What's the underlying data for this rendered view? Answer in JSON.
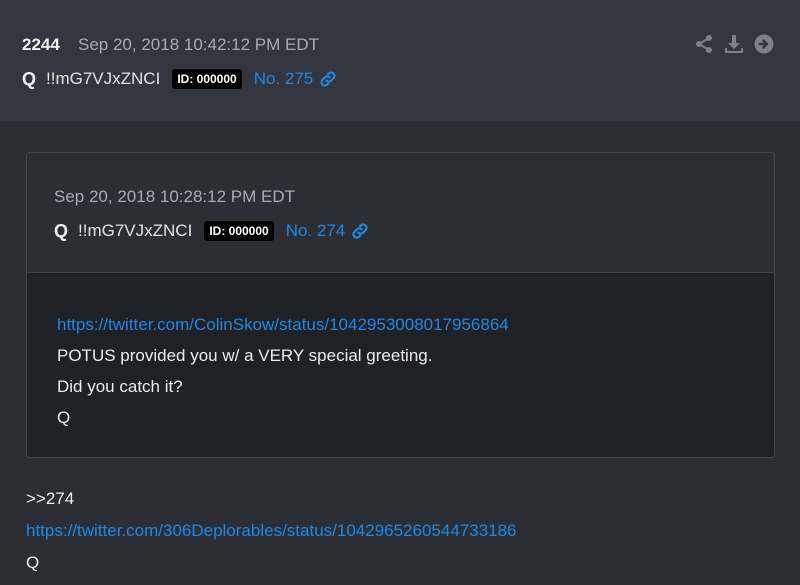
{
  "post": {
    "number": "2244",
    "date": "Sep 20, 2018 10:42:12 PM EDT",
    "author": "Q",
    "tripcode": "!!mG7VJxZNCI",
    "id_badge": "ID: 000000",
    "post_no": "No. 275",
    "icons": [
      "share-icon",
      "download-icon",
      "arrow-right-circle-icon"
    ]
  },
  "quoted": {
    "date": "Sep 20, 2018 10:28:12 PM EDT",
    "author": "Q",
    "tripcode": "!!mG7VJxZNCI",
    "id_badge": "ID: 000000",
    "post_no": "No. 274",
    "link": "https://twitter.com/ColinSkow/status/1042953008017956864",
    "lines": [
      "POTUS provided you w/ a VERY special greeting.",
      "Did you catch it?",
      "Q"
    ]
  },
  "reply": {
    "ref": ">>274",
    "link": "https://twitter.com/306Deplorables/status/1042965260544733186",
    "sign": "Q"
  },
  "colors": {
    "accent": "#1e88e5",
    "background": "#2b2e35",
    "header_bg": "#33363e",
    "quote_body_bg": "#1f2126"
  }
}
